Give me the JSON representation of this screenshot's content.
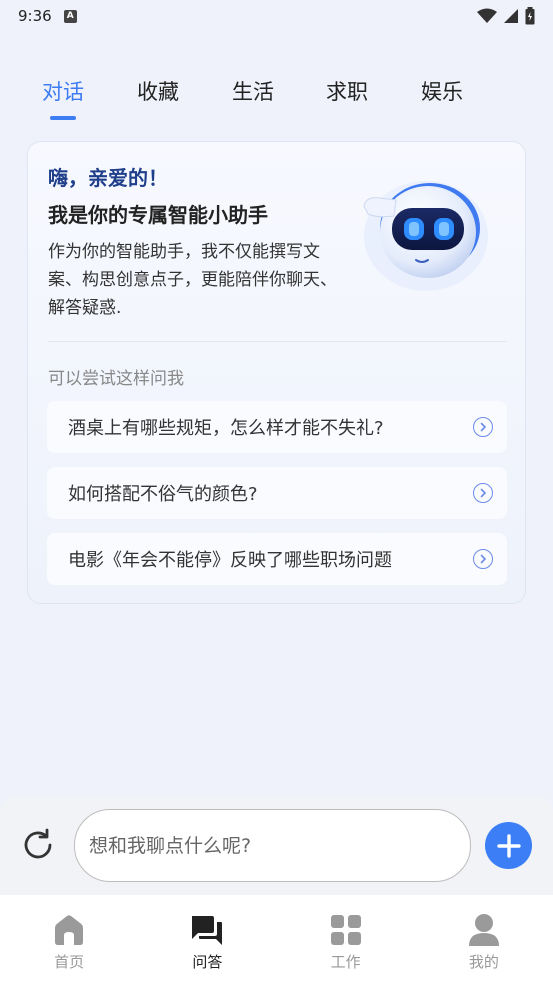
{
  "status": {
    "time": "9:36",
    "badge": "A"
  },
  "tabs": [
    {
      "label": "对话",
      "active": true
    },
    {
      "label": "收藏",
      "active": false
    },
    {
      "label": "生活",
      "active": false
    },
    {
      "label": "求职",
      "active": false
    },
    {
      "label": "娱乐",
      "active": false
    }
  ],
  "card": {
    "greeting": "嗨，亲爱的！",
    "subtitle": "我是你的专属智能小助手",
    "description": "作为你的智能助手，我不仅能撰写文案、构思创意点子，更能陪伴你聊天、解答疑惑.",
    "try_label": "可以尝试这样问我",
    "suggestions": [
      "酒桌上有哪些规矩，怎么样才能不失礼?",
      "如何搭配不俗气的颜色?",
      "电影《年会不能停》反映了哪些职场问题"
    ]
  },
  "input": {
    "placeholder": "想和我聊点什么呢?"
  },
  "nav": [
    {
      "label": "首页",
      "icon": "home-icon",
      "active": false
    },
    {
      "label": "问答",
      "icon": "chat-icon",
      "active": true
    },
    {
      "label": "工作",
      "icon": "grid-icon",
      "active": false
    },
    {
      "label": "我的",
      "icon": "user-icon",
      "active": false
    }
  ],
  "colors": {
    "accent": "#3d7cf3",
    "button": "#3b7ef6",
    "greeting": "#1f3f8a"
  }
}
